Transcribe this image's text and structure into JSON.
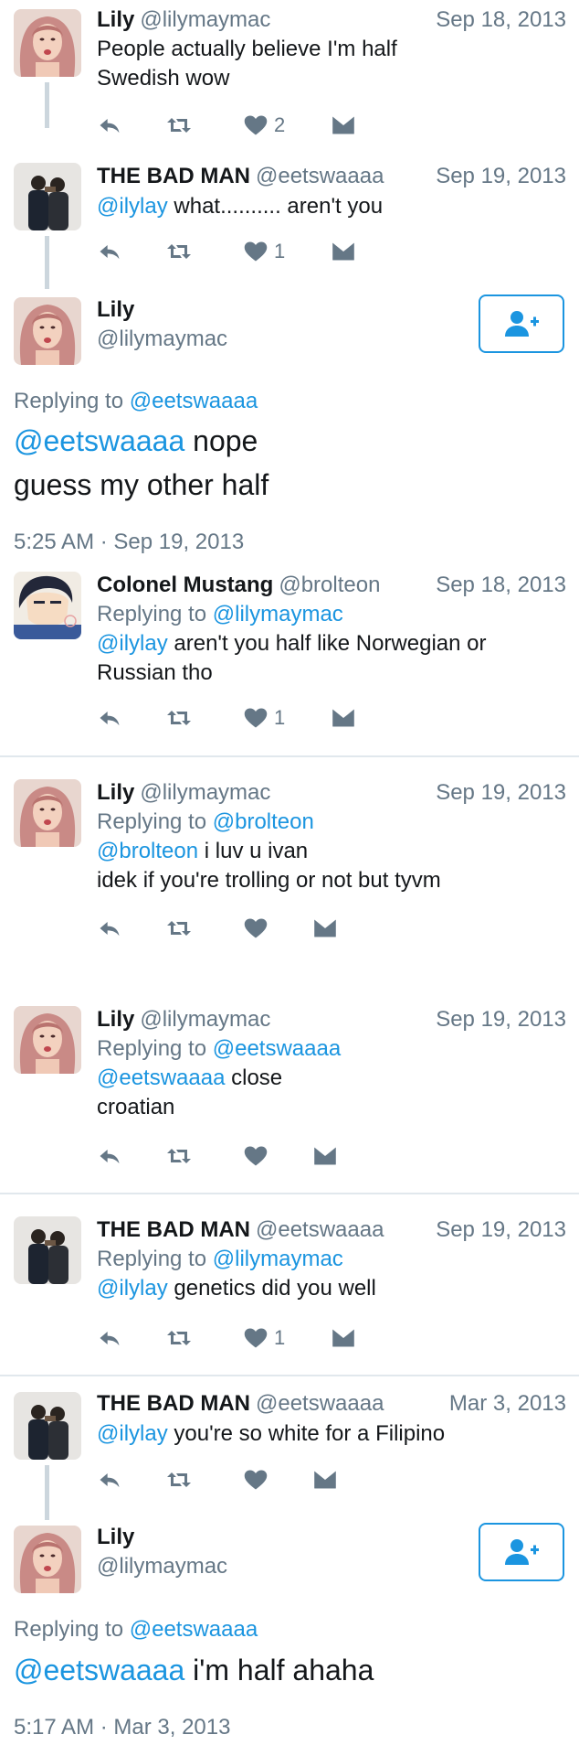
{
  "tweets": [
    {
      "name": "Lily",
      "handle": "@lilymaymac",
      "date": "Sep 18, 2013",
      "text_plain": "People actually believe I'm half Swedish wow",
      "likes": "2"
    },
    {
      "name": "THE BAD MAN",
      "handle": "@eetswaaaa",
      "date": "Sep 19, 2013",
      "mention": "@ilylay",
      "text_rest": " what.......... aren't you",
      "likes": "1"
    },
    {
      "name": "Colonel Mustang",
      "handle": "@brolteon",
      "date": "Sep 18, 2013",
      "replying_prefix": "Replying to",
      "replying_to": "@lilymaymac",
      "mention": "@ilylay",
      "text_rest": " aren't you half like Norwegian or Russian tho",
      "likes": "1"
    },
    {
      "name": "Lily",
      "handle": "@lilymaymac",
      "date": "Sep 19, 2013",
      "replying_prefix": "Replying to",
      "replying_to": "@brolteon",
      "mention": "@brolteon",
      "text_rest": " i luv u ivan",
      "text_line2": "idek if you're trolling or not but tyvm"
    },
    {
      "name": "Lily",
      "handle": "@lilymaymac",
      "date": "Sep 19, 2013",
      "replying_prefix": "Replying to",
      "replying_to": "@eetswaaaa",
      "mention": "@eetswaaaa",
      "text_rest": " close",
      "text_line2": "croatian"
    },
    {
      "name": "THE BAD MAN",
      "handle": "@eetswaaaa",
      "date": "Sep 19, 2013",
      "replying_prefix": "Replying to",
      "replying_to": "@lilymaymac",
      "mention": "@ilylay",
      "text_rest": " genetics did you well",
      "likes": "1"
    },
    {
      "name": "THE BAD MAN",
      "handle": "@eetswaaaa",
      "date": "Mar 3, 2013",
      "mention": "@ilylay",
      "text_rest": " you're so white for a Filipino"
    }
  ],
  "focus1": {
    "name": "Lily",
    "handle": "@lilymaymac",
    "replying_prefix": "Replying to",
    "replying_to": "@eetswaaaa",
    "mention": "@eetswaaaa",
    "text_rest": " nope",
    "text_line2": "guess my other half",
    "timestamp": "5:25 AM · Sep 19, 2013"
  },
  "focus2": {
    "name": "Lily",
    "handle": "@lilymaymac",
    "replying_prefix": "Replying to",
    "replying_to": "@eetswaaaa",
    "mention": "@eetswaaaa",
    "text_rest": " i'm half ahaha",
    "timestamp": "5:17 AM · Mar 3, 2013"
  },
  "icons": [
    "reply-icon",
    "retweet-icon",
    "heart-icon",
    "direct-message-icon",
    "follow-icon"
  ],
  "colors": {
    "link": "#1b95e0",
    "muted": "#657786",
    "text": "#14171a",
    "divider": "#e1e8ed"
  }
}
